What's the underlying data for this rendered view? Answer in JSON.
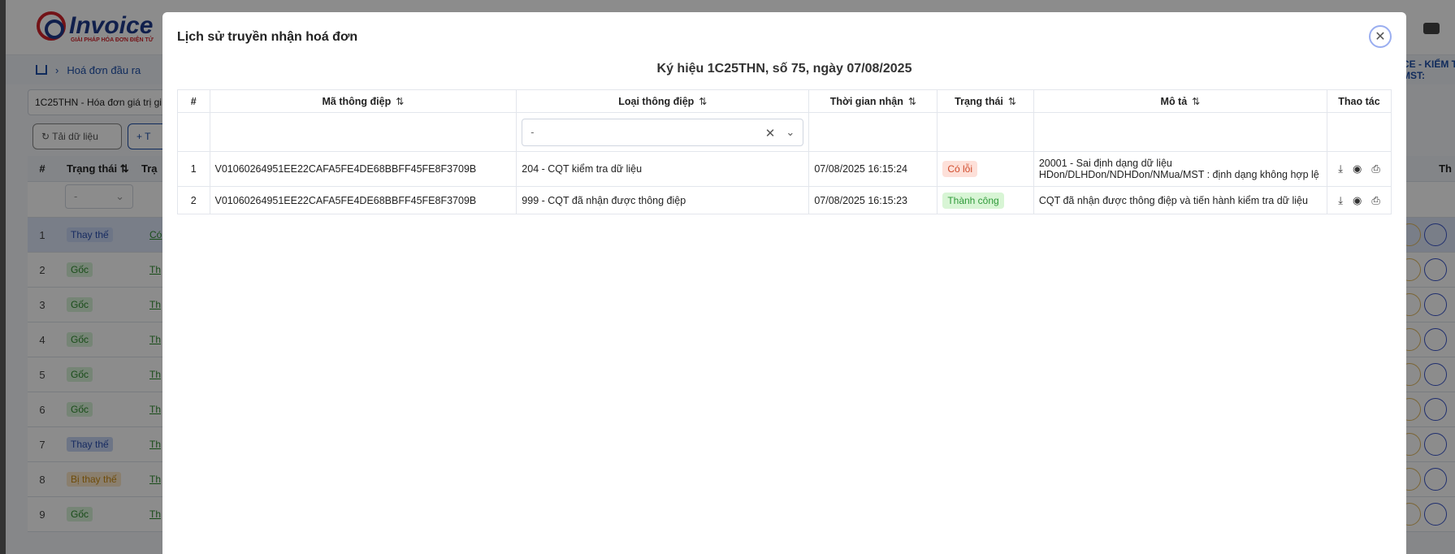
{
  "background": {
    "logo_text": "Invoice",
    "logo_sub": "GIẢI PHÁP HÓA ĐƠN ĐIỆN TỬ",
    "breadcrumb": "Hoá đơn đầu ra",
    "right_text_1": "CE - KIỂM T",
    "right_text_2": "MST:",
    "series_select": "1C25THN - Hóa đơn giá trị gi",
    "reload_button": "Tải dữ liệu",
    "add_button": "+ T",
    "table_header": {
      "num": "#",
      "status": "Trạng thái",
      "status2": "Trạ",
      "right": "Th"
    },
    "filter_value": "-",
    "rows": [
      {
        "n": "1",
        "status": "Thay thế",
        "type": "b",
        "link": "Có"
      },
      {
        "n": "2",
        "status": "Gốc",
        "type": "g",
        "link": "Th"
      },
      {
        "n": "3",
        "status": "Gốc",
        "type": "g",
        "link": "Th"
      },
      {
        "n": "4",
        "status": "Gốc",
        "type": "g",
        "link": "Th"
      },
      {
        "n": "5",
        "status": "Gốc",
        "type": "g",
        "link": "Th"
      },
      {
        "n": "6",
        "status": "Gốc",
        "type": "g",
        "link": "Th"
      },
      {
        "n": "7",
        "status": "Thay thế",
        "type": "b",
        "link": "Th"
      },
      {
        "n": "8",
        "status": "Bị thay thế",
        "type": "o",
        "link": "Th"
      },
      {
        "n": "9",
        "status": "Gốc",
        "type": "g",
        "link": "Th"
      }
    ]
  },
  "modal": {
    "title": "Lịch sử truyền nhận hoá đơn",
    "subtitle": "Ký hiệu 1C25THN, số 75, ngày 07/08/2025",
    "columns": [
      "#",
      "Mã thông điệp",
      "Loại thông điệp",
      "Thời gian nhận",
      "Trạng thái",
      "Mô tả",
      "Thao tác"
    ],
    "filter_select": "-",
    "rows": [
      {
        "n": "1",
        "code": "V01060264951EE22CAFA5FE4DE68BBFF45FE8F3709B",
        "type": "204 - CQT kiểm tra dữ liệu",
        "time": "07/08/2025 16:15:24",
        "status": "Có lỗi",
        "desc_1": "20001 - Sai định dạng dữ liệu",
        "desc_2": "HDon/DLHDon/NDHDon/NMua/MST : định dạng không hợp lệ"
      },
      {
        "n": "2",
        "code": "V01060264951EE22CAFA5FE4DE68BBFF45FE8F3709B",
        "type": "999 - CQT đã nhận được thông điệp",
        "time": "07/08/2025 16:15:23",
        "status": "Thành công",
        "desc_1": "CQT đã nhận được thông điệp và tiến hành kiểm tra dữ liệu"
      }
    ]
  },
  "icons": {
    "sort": "sort-icon",
    "close": "close-icon",
    "download": "download-icon",
    "view": "eye-icon",
    "print": "print-icon"
  }
}
